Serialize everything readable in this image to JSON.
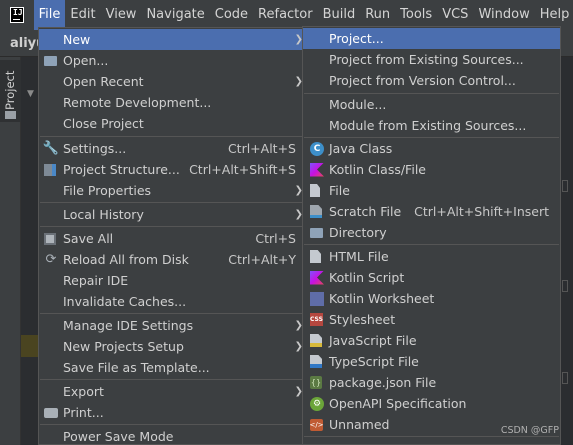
{
  "menubar": {
    "logo_text": "IJ",
    "items": [
      "File",
      "Edit",
      "View",
      "Navigate",
      "Code",
      "Refactor",
      "Build",
      "Run",
      "Tools",
      "VCS",
      "Window",
      "Help"
    ]
  },
  "background": {
    "project_name": "aliyu",
    "side_tab_label": "Project"
  },
  "file_menu": {
    "new": "New",
    "open": "Open...",
    "open_recent": "Open Recent",
    "remote_development": "Remote Development...",
    "close_project": "Close Project",
    "settings": "Settings...",
    "settings_shortcut": "Ctrl+Alt+S",
    "project_structure": "Project Structure...",
    "project_structure_shortcut": "Ctrl+Alt+Shift+S",
    "file_properties": "File Properties",
    "local_history": "Local History",
    "save_all": "Save All",
    "save_all_shortcut": "Ctrl+S",
    "reload_all": "Reload All from Disk",
    "reload_all_shortcut": "Ctrl+Alt+Y",
    "repair_ide": "Repair IDE",
    "invalidate_caches": "Invalidate Caches...",
    "manage_ide_settings": "Manage IDE Settings",
    "new_projects_setup": "New Projects Setup",
    "save_as_template": "Save File as Template...",
    "export": "Export",
    "print": "Print...",
    "power_save_mode": "Power Save Mode"
  },
  "new_menu": {
    "project": "Project...",
    "project_existing_sources": "Project from Existing Sources...",
    "project_vcs": "Project from Version Control...",
    "module": "Module...",
    "module_existing_sources": "Module from Existing Sources...",
    "java_class": "Java Class",
    "kotlin_class": "Kotlin Class/File",
    "file": "File",
    "scratch_file": "Scratch File",
    "scratch_file_shortcut": "Ctrl+Alt+Shift+Insert",
    "directory": "Directory",
    "html_file": "HTML File",
    "kotlin_script": "Kotlin Script",
    "kotlin_worksheet": "Kotlin Worksheet",
    "stylesheet": "Stylesheet",
    "javascript_file": "JavaScript File",
    "typescript_file": "TypeScript File",
    "package_json": "package.json File",
    "openapi_spec": "OpenAPI Specification",
    "unnamed": "Unnamed"
  },
  "watermark": "CSDN @GFP",
  "colors": {
    "menu_bg": "#3c3f41",
    "selection": "#4b6eaf",
    "separator": "#555555",
    "text": "#d0d0d0"
  }
}
